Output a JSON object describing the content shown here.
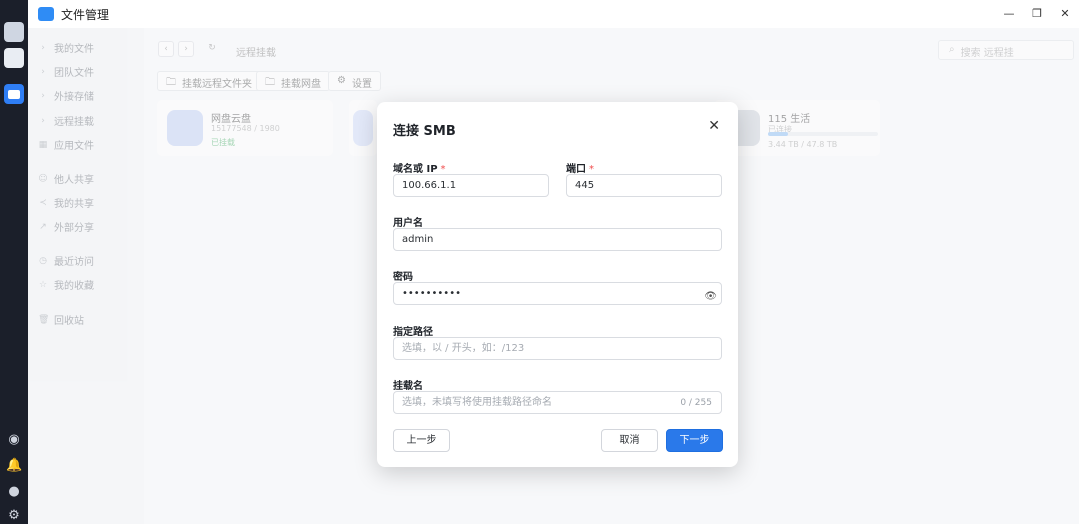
{
  "window": {
    "title": "文件管理",
    "minimize": "—",
    "maximize": "❐",
    "close": "✕"
  },
  "dock": {
    "apps": [
      "desktop-icon",
      "app-store-icon",
      "file-manager-icon"
    ],
    "bottom_icons": [
      "info-icon",
      "bell-icon",
      "user-icon",
      "gear-icon"
    ]
  },
  "sidebar": {
    "items": [
      {
        "label": "我的文件",
        "mark": "›"
      },
      {
        "label": "团队文件",
        "mark": "›"
      },
      {
        "label": "外接存储",
        "mark": "›"
      },
      {
        "label": "远程挂载",
        "mark": "›"
      },
      {
        "label": "应用文件",
        "mark": "▦"
      },
      {
        "label": "他人共享",
        "mark": "☺"
      },
      {
        "label": "我的共享",
        "mark": "≺"
      },
      {
        "label": "外部分享",
        "mark": "↗"
      },
      {
        "label": "最近访问",
        "mark": "◷"
      },
      {
        "label": "我的收藏",
        "mark": "☆"
      },
      {
        "label": "回收站",
        "mark": "🗑"
      }
    ]
  },
  "main": {
    "path": "远程挂载",
    "search_placeholder": "搜索 远程挂",
    "toolbar": {
      "mount_remote": "挂载远程文件夹",
      "mount_cloud": "挂载网盘",
      "settings": "设置"
    },
    "cards": [
      {
        "name": "网盘云盘",
        "sub": "15177548 / 1980",
        "status": "已挂载"
      },
      {
        "name": "115 生活",
        "sub": "已连接",
        "size": "3.44 TB / 47.8 TB",
        "used_fraction": 0.18
      }
    ]
  },
  "modal": {
    "title": "连接 SMB",
    "close": "✕",
    "host": {
      "label": "域名或 IP",
      "required": "*",
      "value": "100.66.1.1"
    },
    "port": {
      "label": "端口",
      "required": "*",
      "value": "445"
    },
    "username": {
      "label": "用户名",
      "value": "admin"
    },
    "password": {
      "label": "密码",
      "value": "••••••••••"
    },
    "path": {
      "label": "指定路径",
      "placeholder": "选填，以 / 开头，如：/123"
    },
    "mount_name": {
      "label": "挂载名",
      "placeholder": "选填，未填写将使用挂载路径命名",
      "counter": "0 / 255"
    },
    "buttons": {
      "prev": "上一步",
      "cancel": "取消",
      "next": "下一步"
    }
  }
}
